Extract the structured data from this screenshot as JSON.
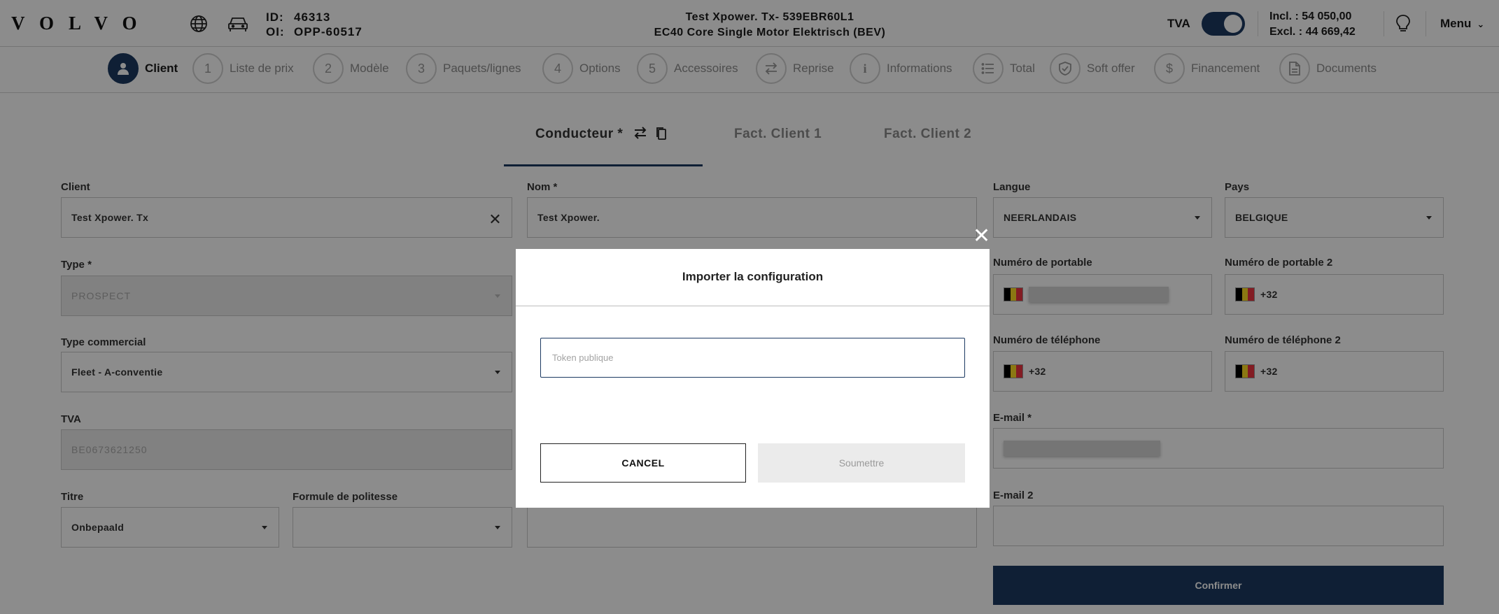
{
  "header": {
    "logo": "VOLVO",
    "id_label": "ID:",
    "id_value": "46313",
    "oi_label": "OI:",
    "oi_value": "OPP-60517",
    "title_line1": "Test Xpower. Tx- 539EBR60L1",
    "title_line2": "EC40 Core Single Motor Elektrisch (BEV)",
    "tva_label": "TVA",
    "tva_enabled": true,
    "incl_price": "Incl. : 54 050,00",
    "excl_price": "Excl. : 44 669,42",
    "menu_label": "Menu"
  },
  "stepper": [
    {
      "marker": "",
      "label": "Client",
      "icon": "person-icon",
      "active": true
    },
    {
      "marker": "1",
      "label": "Liste de prix"
    },
    {
      "marker": "2",
      "label": "Modèle"
    },
    {
      "marker": "3",
      "label": "Paquets/lignes"
    },
    {
      "marker": "4",
      "label": "Options"
    },
    {
      "marker": "5",
      "label": "Accessoires"
    },
    {
      "marker": "",
      "label": "Reprise",
      "icon": "swap-icon"
    },
    {
      "marker": "i",
      "label": "Informations",
      "icon": "info-icon"
    },
    {
      "marker": "",
      "label": "Total",
      "icon": "list-icon"
    },
    {
      "marker": "",
      "label": "Soft offer",
      "icon": "shield-check-icon"
    },
    {
      "marker": "$",
      "label": "Financement",
      "icon": "dollar-icon"
    },
    {
      "marker": "",
      "label": "Documents",
      "icon": "document-icon"
    }
  ],
  "tabs": {
    "conducteur": "Conducteur *",
    "fact_client_1": "Fact. Client 1",
    "fact_client_2": "Fact. Client 2"
  },
  "form": {
    "client_label": "Client",
    "client_value": "Test Xpower. Tx",
    "nom_label": "Nom *",
    "nom_value": "Test Xpower.",
    "langue_label": "Langue",
    "langue_value": "NEERLANDAIS",
    "pays_label": "Pays",
    "pays_value": "BELGIQUE",
    "type_label": "Type *",
    "type_value": "PROSPECT",
    "portable_label": "Numéro de portable",
    "portable2_label": "Numéro de portable 2",
    "portable2_value": "+32",
    "type_commercial_label": "Type commercial",
    "type_commercial_value": "Fleet - A-conventie",
    "telephone_label": "Numéro de téléphone",
    "telephone_value": "+32",
    "telephone2_label": "Numéro de téléphone 2",
    "telephone2_value": "+32",
    "tva_label": "TVA",
    "tva_value": "BE0673621250",
    "email_label": "E-mail *",
    "titre_label": "Titre",
    "titre_value": "Onbepaald",
    "formule_label": "Formule de politesse",
    "formule_value": "",
    "email2_label": "E-mail 2",
    "confirm_label": "Confirmer"
  },
  "modal": {
    "title": "Importer la configuration",
    "input_placeholder": "Token publique",
    "input_value": "",
    "cancel_label": "CANCEL",
    "submit_label": "Soumettre"
  },
  "colors": {
    "accent": "#1c3a62",
    "overlay": "rgba(0,0,0,0.45)",
    "flag_black": "#000000",
    "flag_yellow": "#fdda24",
    "flag_red": "#ef3340"
  }
}
